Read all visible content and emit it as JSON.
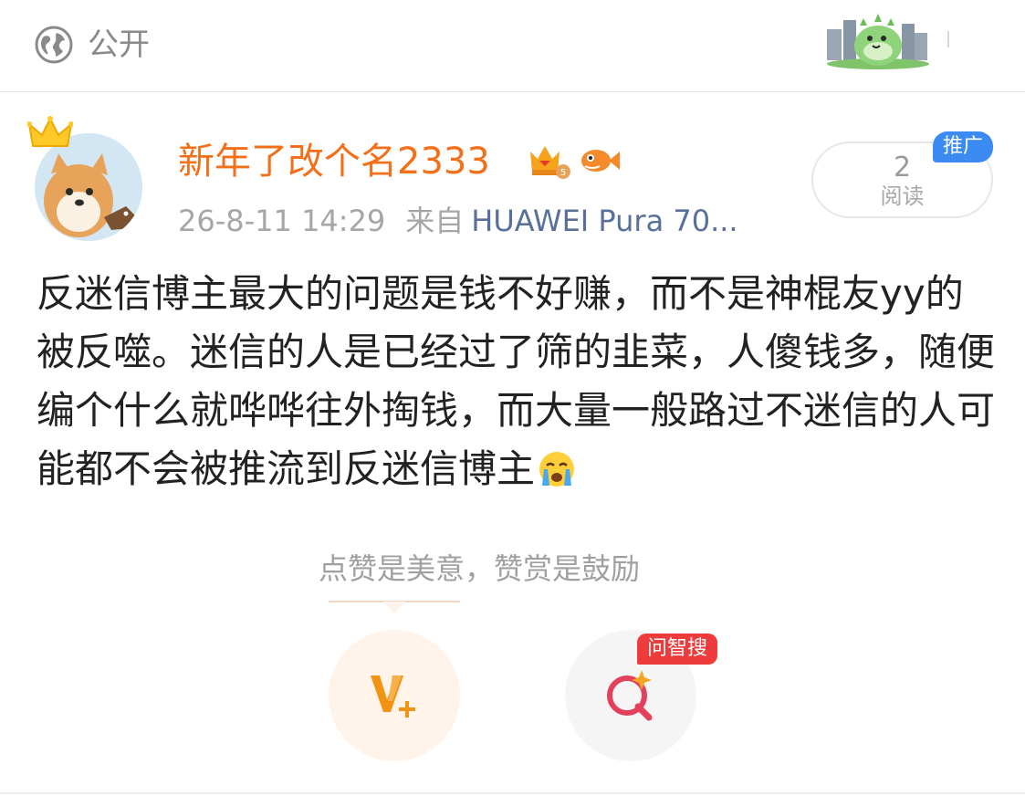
{
  "header": {
    "visibility_label": "公开",
    "visibility_icon": "globe-icon",
    "decoration": "dinosaur-sticker"
  },
  "author": {
    "name": "新年了改个名2333",
    "name_color": "#f36f19",
    "timestamp": "26-8-11 14:29",
    "source_prefix": "来自",
    "device": "HUAWEI Pura 70..."
  },
  "stats": {
    "read_count": "2",
    "read_label": "阅读",
    "promo_label": "推广"
  },
  "post": {
    "text": "反迷信博主最大的问题是钱不好赚，而不是神棍友yy的被反噬。迷信的人是已经过了筛的韭菜，人傻钱多，随便编个什么就哗哗往外掏钱，而大量一般路过不迷信的人可能都不会被推流到反迷信博主",
    "trailing_emoji": "crying-face-emoji"
  },
  "reward": {
    "slogan": "点赞是美意，赞赏是鼓励",
    "reward_icon": "reward-v-plus-icon",
    "search_icon": "smart-search-icon",
    "search_badge": "问智搜"
  },
  "colors": {
    "accent_orange": "#f36f19",
    "promo_blue": "#3b8bf3",
    "badge_red": "#ee3b3b",
    "device_link": "#58709a"
  }
}
